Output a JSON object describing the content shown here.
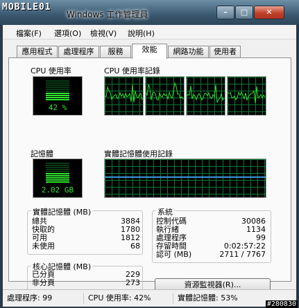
{
  "watermark_logo": "MOBILE01",
  "window_title": "Windows 工作管理員",
  "caption": {
    "min": "–",
    "max": "□",
    "close": "✕"
  },
  "menu": [
    "檔案(F)",
    "選項(O)",
    "檢視(V)",
    "說明(H)"
  ],
  "tabs": [
    "應用程式",
    "處理程序",
    "服務",
    "效能",
    "網路功能",
    "使用者"
  ],
  "active_tab": "效能",
  "cpu": {
    "usage_label": "CPU 使用率",
    "usage_value": "42 %",
    "usage_fraction": 0.42,
    "history_label": "CPU 使用率記錄",
    "core_count": 4
  },
  "memory": {
    "label": "記憶體",
    "value": "2.02 GB",
    "used_fraction": 0.53,
    "history_label": "實體記憶體使用記錄"
  },
  "physical_memory": {
    "title": "實體記憶體 (MB)",
    "rows": [
      {
        "label": "總共",
        "value": "3884"
      },
      {
        "label": "快取的",
        "value": "1780"
      },
      {
        "label": "可用",
        "value": "1812"
      },
      {
        "label": "未使用",
        "value": "68"
      }
    ]
  },
  "kernel_memory": {
    "title": "核心記憶體 (MB)",
    "rows": [
      {
        "label": "已分頁",
        "value": "229"
      },
      {
        "label": "非分頁",
        "value": "273"
      }
    ]
  },
  "system": {
    "title": "系統",
    "rows": [
      {
        "label": "控制代碼",
        "value": "30086"
      },
      {
        "label": "執行緒",
        "value": "1134"
      },
      {
        "label": "處理程序",
        "value": "99"
      },
      {
        "label": "存留時間",
        "value": "0:02:57:22"
      },
      {
        "label": "認可 (MB)",
        "value": "2711 / 7767"
      }
    ]
  },
  "resource_monitor_button": "資源監視器(R)...",
  "status": {
    "processes": "處理程序: 99",
    "cpu": "CPU 使用率: 42%",
    "memory": "實體記憶體: 53%"
  },
  "watermark_id": "#280830",
  "colors": {
    "graph_green": "#2fe22f",
    "grid_green": "#0b7a33",
    "memory_line": "#3e9be0"
  }
}
